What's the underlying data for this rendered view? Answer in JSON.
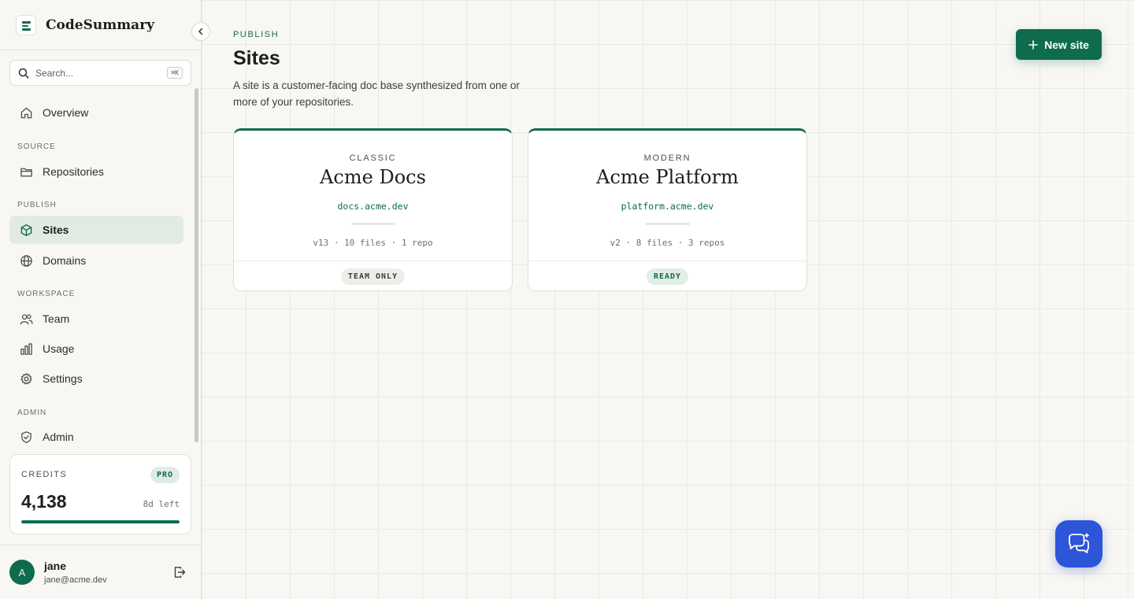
{
  "app": {
    "name": "CodeSummary",
    "brand_color": "#0f6b4e",
    "chat_color": "#2d55d8"
  },
  "search": {
    "placeholder": "Search...",
    "shortcut": "⌘K"
  },
  "nav": {
    "overview": "Overview",
    "sections": {
      "source": "SOURCE",
      "publish": "PUBLISH",
      "workspace": "WORKSPACE",
      "admin": "ADMIN"
    },
    "repositories": "Repositories",
    "sites": "Sites",
    "domains": "Domains",
    "team": "Team",
    "usage": "Usage",
    "settings": "Settings",
    "admin": "Admin",
    "active": "Sites"
  },
  "credits": {
    "label": "CREDITS",
    "plan": "PRO",
    "value": "4,138",
    "time_left": "8d left",
    "fill_fraction": 1.0
  },
  "user": {
    "initial": "A",
    "name": "jane",
    "email": "jane@acme.dev"
  },
  "page": {
    "eyebrow": "PUBLISH",
    "title": "Sites",
    "description": "A site is a customer-facing doc base synthesized from one or more of your repositories.",
    "new_button": "New site"
  },
  "sites": [
    {
      "style": "CLASSIC",
      "name": "Acme Docs",
      "domain": "docs.acme.dev",
      "meta": "v13 · 10 files · 1 repo",
      "status": "TEAM ONLY"
    },
    {
      "style": "MODERN",
      "name": "Acme Platform",
      "domain": "platform.acme.dev",
      "meta": "v2 · 8 files · 3 repos",
      "status": "READY"
    }
  ]
}
